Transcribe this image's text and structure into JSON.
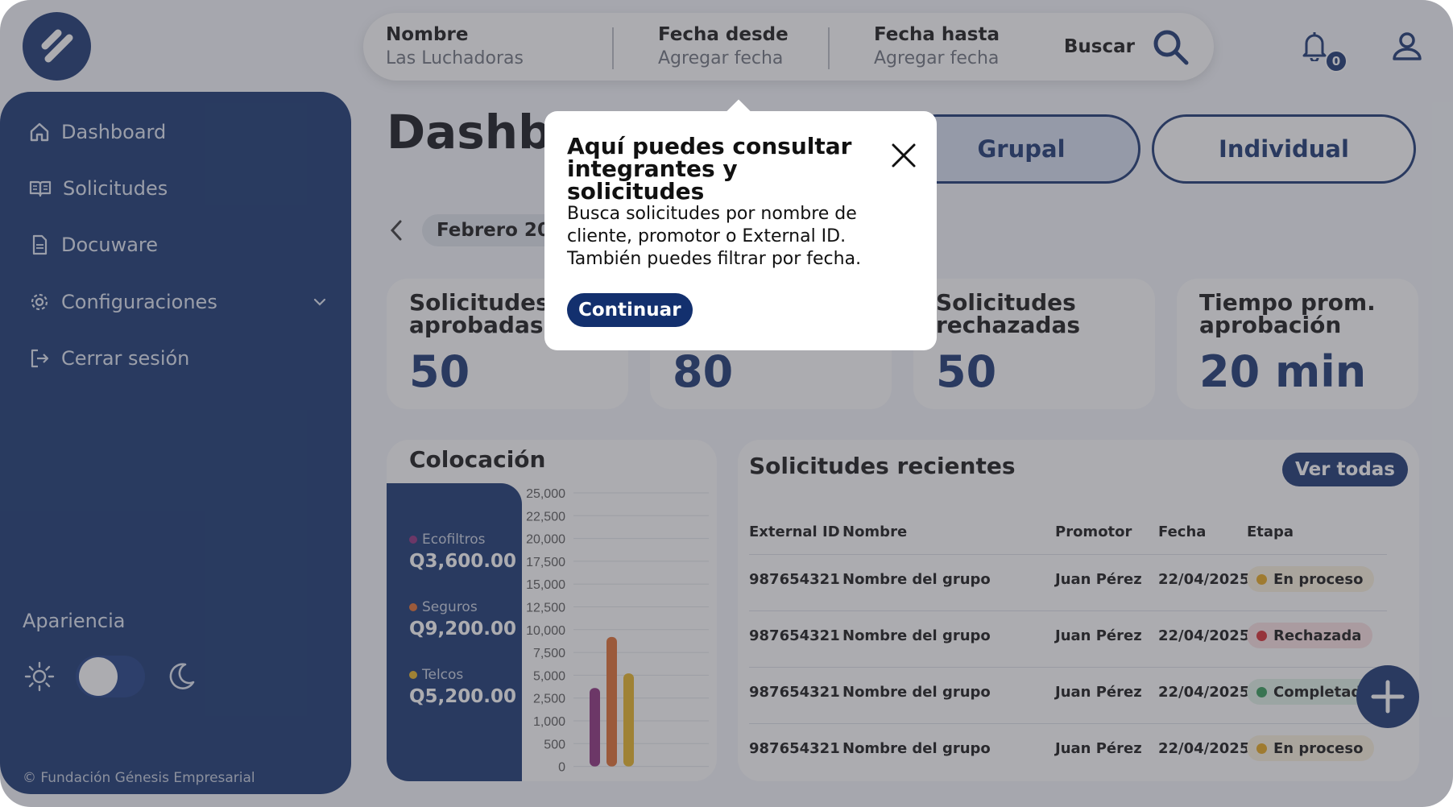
{
  "colors": {
    "brand": "#13306e",
    "ecofiltros": "#8a2a7a",
    "seguros": "#e06a2b",
    "telcos": "#e8b320",
    "in_process": "#e8a617",
    "rejected": "#d7262b",
    "completed": "#2f9a55"
  },
  "search": {
    "name_label": "Nombre",
    "name_value": "Las Luchadoras",
    "from_label": "Fecha desde",
    "from_value": "Agregar fecha",
    "to_label": "Fecha hasta",
    "to_value": "Agregar fecha",
    "button_label": "Buscar",
    "icon": "search-icon"
  },
  "header": {
    "notifications_count": "0",
    "notification_icon": "bell-icon",
    "user_icon": "user-icon"
  },
  "sidebar": {
    "items": [
      {
        "label": "Dashboard",
        "icon": "home-icon"
      },
      {
        "label": "Solicitudes",
        "icon": "book-icon"
      },
      {
        "label": "Docuware",
        "icon": "document-icon"
      },
      {
        "label": "Configuraciones",
        "icon": "gear-icon"
      },
      {
        "label": "Cerrar sesión",
        "icon": "logout-icon"
      }
    ],
    "appearance_label": "Apariencia",
    "copyright": "© Fundación Génesis Empresarial"
  },
  "main": {
    "title": "Dashboard",
    "segments": [
      "Grupal",
      "Individual"
    ],
    "month": "Febrero 2025",
    "stats": [
      {
        "label": "Solicitudes aprobadas",
        "value": "50"
      },
      {
        "label": "",
        "value": "80"
      },
      {
        "label": "Solicitudes rechazadas",
        "value": "50"
      },
      {
        "label": "Tiempo prom. aprobación",
        "value": "20 min"
      }
    ]
  },
  "colocacion": {
    "title": "Colocación",
    "legend": [
      {
        "name": "Ecofiltros",
        "value": "Q3,600.00"
      },
      {
        "name": "Seguros",
        "value": "Q9,200.00"
      },
      {
        "name": "Telcos",
        "value": "Q5,200.00"
      }
    ]
  },
  "chart_data": {
    "type": "bar",
    "categories": [
      "Ecofiltros",
      "Seguros",
      "Telcos"
    ],
    "values": [
      3600,
      9200,
      5200
    ],
    "y_ticks": [
      "25,000",
      "22,500",
      "20,000",
      "17,500",
      "15,000",
      "12,500",
      "10,000",
      "7,500",
      "5,000",
      "2,500",
      "1,000",
      "500",
      "0"
    ],
    "tick_values": [
      25000,
      22500,
      20000,
      17500,
      15000,
      12500,
      10000,
      7500,
      5000,
      2500,
      1000,
      500,
      0
    ],
    "grid": true
  },
  "recent": {
    "title": "Solicitudes recientes",
    "view_all": "Ver todas",
    "columns": [
      "External ID",
      "Nombre",
      "Promotor",
      "Fecha",
      "Etapa"
    ],
    "rows": [
      {
        "id": "987654321",
        "name": "Nombre del grupo",
        "promoter": "Juan Pérez",
        "date": "22/04/2025",
        "stage": "En proceso",
        "stage_color": "#e8a617",
        "stage_bg": "#fbf2dc"
      },
      {
        "id": "987654321",
        "name": "Nombre del grupo",
        "promoter": "Juan Pérez",
        "date": "22/04/2025",
        "stage": "Rechazada",
        "stage_color": "#d7262b",
        "stage_bg": "#fbe1e2"
      },
      {
        "id": "987654321",
        "name": "Nombre del grupo",
        "promoter": "Juan Pérez",
        "date": "22/04/2025",
        "stage": "Completada",
        "stage_color": "#2f9a55",
        "stage_bg": "#e1f3e7"
      },
      {
        "id": "987654321",
        "name": "Nombre del grupo",
        "promoter": "Juan Pérez",
        "date": "22/04/2025",
        "stage": "En proceso",
        "stage_color": "#e8a617",
        "stage_bg": "#fbf2dc"
      }
    ]
  },
  "popover": {
    "title": "Aquí puedes consultar integrantes y solicitudes",
    "body": "Busca solicitudes por nombre de cliente, promotor o External ID. También puedes filtrar por fecha.",
    "button": "Continuar"
  }
}
